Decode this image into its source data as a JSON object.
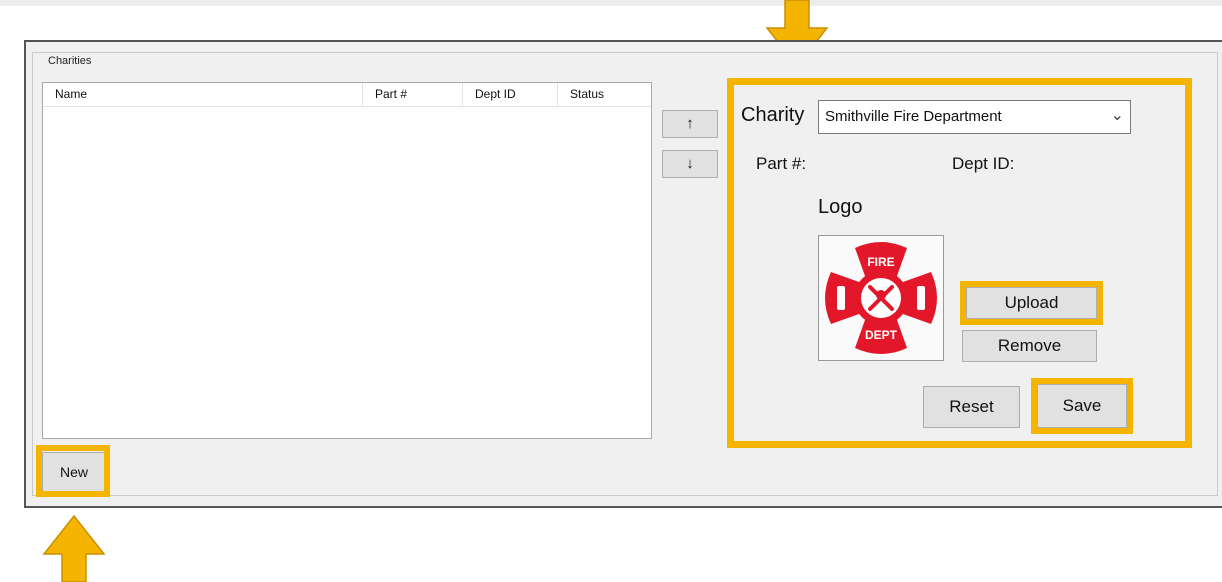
{
  "groupbox": {
    "title": "Charities"
  },
  "listview": {
    "columns": [
      "Name",
      "Part #",
      "Dept ID",
      "Status"
    ],
    "rows": []
  },
  "move_buttons": {
    "up": "↑",
    "down": "↓"
  },
  "details": {
    "charity_label": "Charity",
    "charity_selected": "Smithville Fire Department",
    "part_label": "Part #:",
    "dept_label": "Dept ID:",
    "logo_label": "Logo",
    "logo_text_top": "FIRE",
    "logo_text_bottom": "DEPT",
    "upload_label": "Upload",
    "remove_label": "Remove",
    "reset_label": "Reset",
    "save_label": "Save"
  },
  "new_label": "New",
  "icons": {
    "logo": "fire-dept-maltese-cross-icon",
    "combo": "chevron-down-icon",
    "annotation": "arrow-icon"
  },
  "colors": {
    "highlight": "#f5b400",
    "logo_red": "#e3172a",
    "panel_bg": "#f0f0f0"
  }
}
